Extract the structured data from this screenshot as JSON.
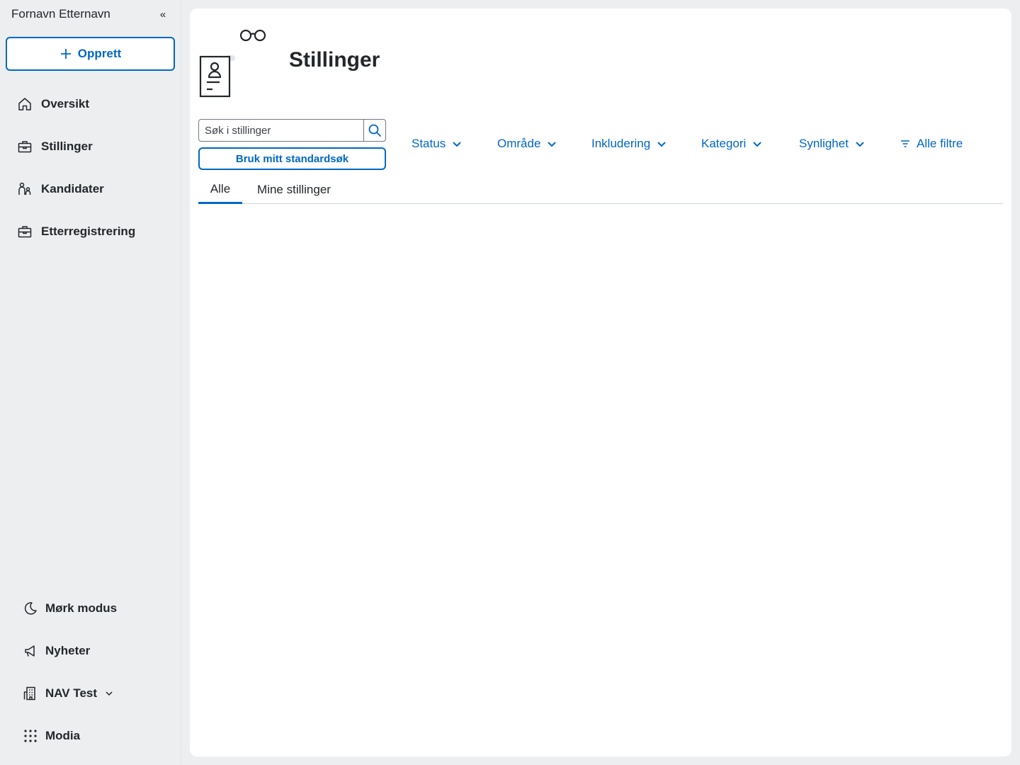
{
  "sidebar": {
    "user_name": "Fornavn Etternavn",
    "create_label": "Opprett",
    "nav": [
      {
        "label": "Oversikt",
        "icon": "house-icon"
      },
      {
        "label": "Stillinger",
        "icon": "briefcase-icon"
      },
      {
        "label": "Kandidater",
        "icon": "people-icon"
      },
      {
        "label": "Etterregistrering",
        "icon": "briefcase-icon"
      }
    ],
    "bottom": [
      {
        "label": "Mørk modus",
        "icon": "moon-icon"
      },
      {
        "label": "Nyheter",
        "icon": "megaphone-icon"
      },
      {
        "label": "NAV Test",
        "icon": "buildings-icon"
      },
      {
        "label": "Modia",
        "icon": "grid-icon"
      }
    ]
  },
  "main": {
    "title": "Stillinger",
    "search": {
      "placeholder": "Søk i stillinger",
      "value": ""
    },
    "standard_search_label": "Bruk mitt standardsøk",
    "filters": [
      "Status",
      "Område",
      "Inkludering",
      "Kategori",
      "Synlighet"
    ],
    "all_filters_label": "Alle filtre",
    "tabs": [
      {
        "label": "Alle",
        "active": true
      },
      {
        "label": "Mine stillinger",
        "active": false
      }
    ]
  },
  "colors": {
    "accent": "#0067c5",
    "text": "#23262a",
    "sidebar_bg": "#eceef0",
    "content_bg": "#ffffff"
  }
}
